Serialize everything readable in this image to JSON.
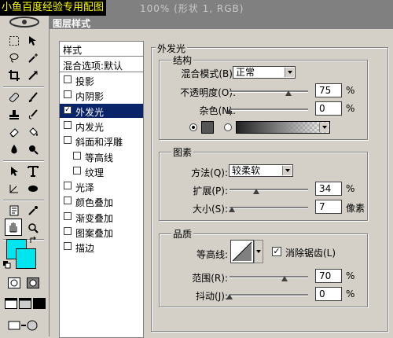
{
  "watermark": "小鱼百度经验专用配图",
  "doc_title": "100% (形状 1, RGB)",
  "dialog": {
    "title": "图层样式"
  },
  "styles_panel": {
    "header": "样式",
    "blending_options": "混合选项:默认",
    "items": [
      {
        "label": "投影",
        "checked": false
      },
      {
        "label": "内阴影",
        "checked": false
      },
      {
        "label": "外发光",
        "checked": true,
        "selected": true
      },
      {
        "label": "内发光",
        "checked": false
      },
      {
        "label": "斜面和浮雕",
        "checked": false
      },
      {
        "label": "等高线",
        "checked": false
      },
      {
        "label": "纹理",
        "checked": false
      },
      {
        "label": "光泽",
        "checked": false
      },
      {
        "label": "颜色叠加",
        "checked": false
      },
      {
        "label": "渐变叠加",
        "checked": false
      },
      {
        "label": "图案叠加",
        "checked": false
      },
      {
        "label": "描边",
        "checked": false
      }
    ]
  },
  "outer_glow": {
    "title": "外发光",
    "structure": {
      "title": "结构",
      "blend_mode_label": "混合模式(B):",
      "blend_mode_value": "正常",
      "opacity_label": "不透明度(O):",
      "opacity_value": "75",
      "noise_label": "杂色(N):",
      "noise_value": "0",
      "percent": "%"
    },
    "elements": {
      "title": "图素",
      "technique_label": "方法(Q):",
      "technique_value": "较柔软",
      "spread_label": "扩展(P):",
      "spread_value": "34",
      "size_label": "大小(S):",
      "size_value": "7",
      "px_unit": "像素",
      "percent": "%"
    },
    "quality": {
      "title": "品质",
      "contour_label": "等高线:",
      "antialias_label": "消除锯齿(L)",
      "antialias_checked": true,
      "range_label": "范围(R):",
      "range_value": "70",
      "jitter_label": "抖动(J):",
      "jitter_value": "0",
      "percent": "%"
    }
  },
  "toolbox": {
    "foreground_color": "#00e5ee",
    "background_color": "#00e5ee",
    "glow_color": "#555555"
  }
}
